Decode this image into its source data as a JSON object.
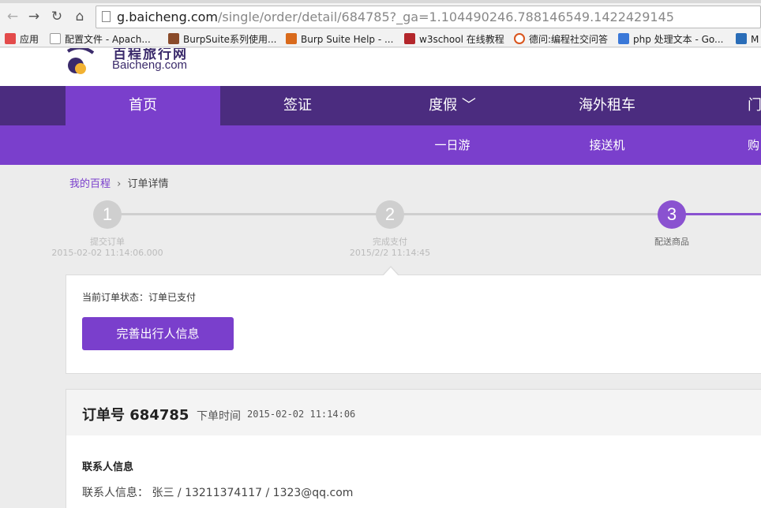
{
  "browser": {
    "url_host": "g.baicheng.com",
    "url_path": "/single/order/detail/684785?_ga=1.104490246.788146549.1422429145",
    "bookmarks": [
      {
        "label": "应用",
        "icon": "apps-grid-icon",
        "color": "#d44"
      },
      {
        "label": "配置文件 - Apach...",
        "icon": "document-icon",
        "color": "#999"
      },
      {
        "label": "BurpSuite系列使用...",
        "icon": "burp-icon",
        "color": "#8a4b2a"
      },
      {
        "label": "Burp Suite Help - ...",
        "icon": "burp-help-icon",
        "color": "#d96a1c"
      },
      {
        "label": "w3school 在线教程",
        "icon": "w3school-icon",
        "color": "#b3262b"
      },
      {
        "label": "德问:编程社交问答",
        "icon": "dewen-icon",
        "color": "#d9541c"
      },
      {
        "label": "php 处理文本 - Go...",
        "icon": "google-icon",
        "color": "#3a78d8"
      },
      {
        "label": "M",
        "icon": "bookmark-icon",
        "color": "#2a6db8"
      }
    ]
  },
  "header": {
    "logo_cn": "百程旅行网",
    "logo_en": "Baicheng.com"
  },
  "mainnav": [
    "首页",
    "签证",
    "度假 ﹀",
    "海外租车",
    "门"
  ],
  "subnav": [
    "一日游",
    "接送机",
    "购"
  ],
  "breadcrumb": {
    "home": "我的百程",
    "sep": "›",
    "current": "订单详情"
  },
  "steps": [
    {
      "num": "1",
      "label": "提交订单",
      "time": "2015-02-02 11:14:06.000"
    },
    {
      "num": "2",
      "label": "完成支付",
      "time": "2015/2/2 11:14:45"
    },
    {
      "num": "3",
      "label": "配送商品",
      "time": ""
    }
  ],
  "status": {
    "text": "当前订单状态：订单已支付",
    "button": "完善出行人信息"
  },
  "order": {
    "number_label": "订单号 684785",
    "time_label": "下单时间",
    "time": "2015-02-02 11:14:06",
    "contact_title": "联系人信息",
    "contact_line": "联系人信息：  张三 / 13211374117 / 1323@qq.com"
  },
  "colors": {
    "brand_dark": "#4b2c7f",
    "brand": "#7a3fcc",
    "step_active": "#8a52d0"
  }
}
